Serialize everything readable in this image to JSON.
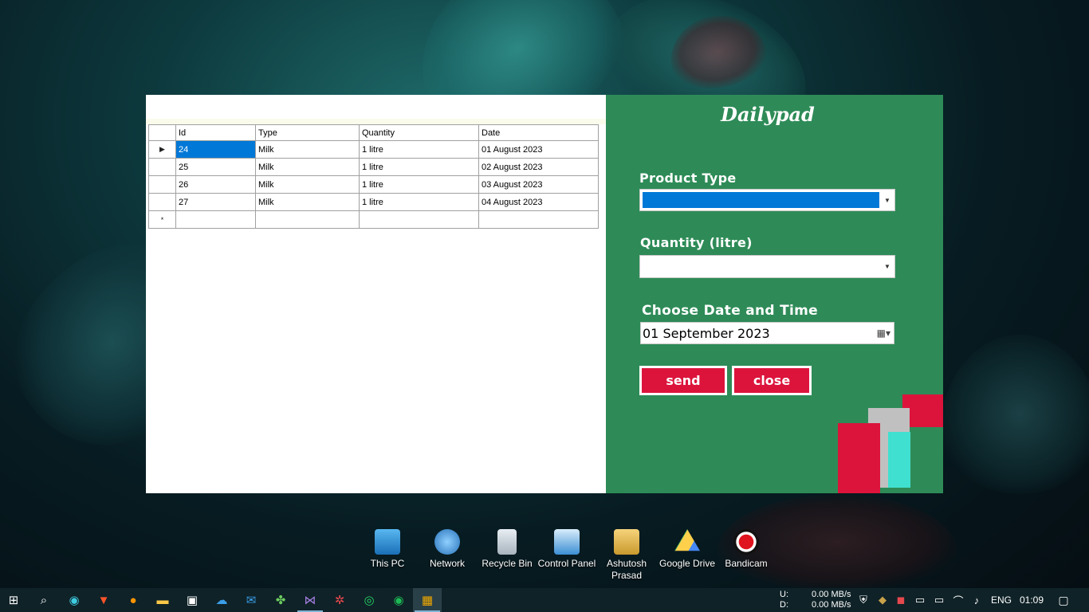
{
  "app": {
    "title": "Dailypad",
    "grid": {
      "columns": [
        "Id",
        "Type",
        "Quantity",
        "Date"
      ],
      "rows": [
        {
          "id": "24",
          "type": "Milk",
          "quantity": "1 litre",
          "date": "01 August 2023"
        },
        {
          "id": "25",
          "type": "Milk",
          "quantity": "1 litre",
          "date": "02 August 2023"
        },
        {
          "id": "26",
          "type": "Milk",
          "quantity": "1 litre",
          "date": "03 August 2023"
        },
        {
          "id": "27",
          "type": "Milk",
          "quantity": "1 litre",
          "date": "04 August 2023"
        }
      ],
      "current_row_marker": "▶",
      "new_row_marker": "*"
    },
    "form": {
      "product_type_label": "Product Type",
      "product_type_value": "",
      "quantity_label": "Quantity (litre)",
      "quantity_value": "",
      "date_label": "Choose Date and Time",
      "date_value": "01 September 2023",
      "send_label": "send",
      "close_label": "close"
    },
    "colors": {
      "panel": "#2e8b57",
      "button": "#dc143c",
      "selection": "#0078d7",
      "deco_red": "#dc143c",
      "deco_gray": "#c0c0c0",
      "deco_teal": "#40e0d0"
    }
  },
  "desktop": {
    "icons": [
      {
        "label": "This PC",
        "icon": "computer-icon"
      },
      {
        "label": "Network",
        "icon": "network-icon"
      },
      {
        "label": "Recycle Bin",
        "icon": "recycle-bin-icon"
      },
      {
        "label": "Control Panel",
        "icon": "control-panel-icon"
      },
      {
        "label": "Ashutosh Prasad",
        "icon": "user-folder-icon"
      },
      {
        "label": "Google Drive",
        "icon": "google-drive-icon"
      },
      {
        "label": "Bandicam",
        "icon": "bandicam-icon"
      }
    ]
  },
  "taskbar": {
    "apps": [
      "windows-start-icon",
      "search-icon",
      "edge-icon",
      "brave-icon",
      "firefox-icon",
      "file-explorer-icon",
      "store-icon",
      "onedrive-icon",
      "mail-icon",
      "xbox-icon",
      "visual-studio-icon",
      "davinci-icon",
      "whatsapp-icon",
      "spotify-icon",
      "dailypad-app-icon"
    ],
    "net_up_label": "U:",
    "net_down_label": "D:",
    "net_up": "0.00 MB/s",
    "net_down": "0.00 MB/s",
    "language": "ENG",
    "time": "01:09"
  }
}
